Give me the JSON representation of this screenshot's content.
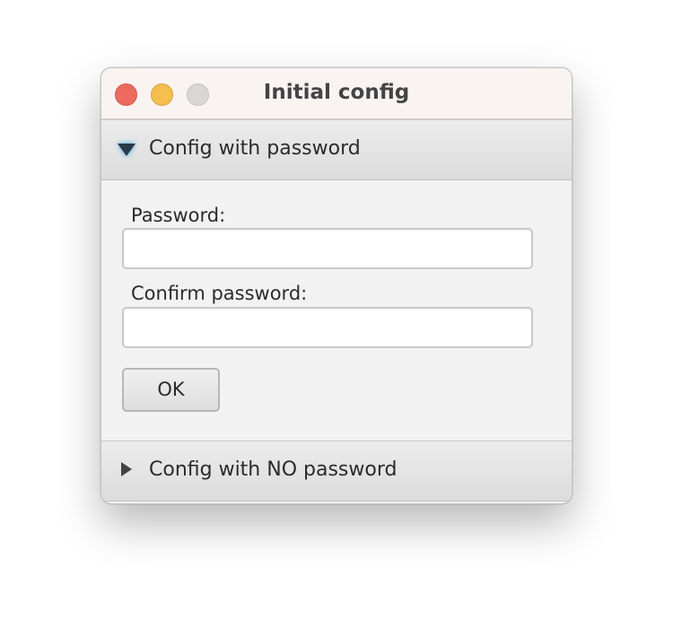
{
  "window": {
    "title": "Initial config"
  },
  "sections": [
    {
      "label": "Config with password",
      "expanded": true,
      "fields": {
        "password_label": "Password:",
        "password_value": "",
        "confirm_label": "Confirm password:",
        "confirm_value": ""
      },
      "ok_label": "OK"
    },
    {
      "label": "Config with NO password",
      "expanded": false
    }
  ],
  "icons": {
    "expanded": "triangle-down-icon",
    "collapsed": "triangle-right-icon"
  },
  "colors": {
    "close": "#ec6a5e",
    "minimize": "#f4bf4f",
    "maximize": "#d9d6d5",
    "focus_glow": "#2ba4e8"
  }
}
